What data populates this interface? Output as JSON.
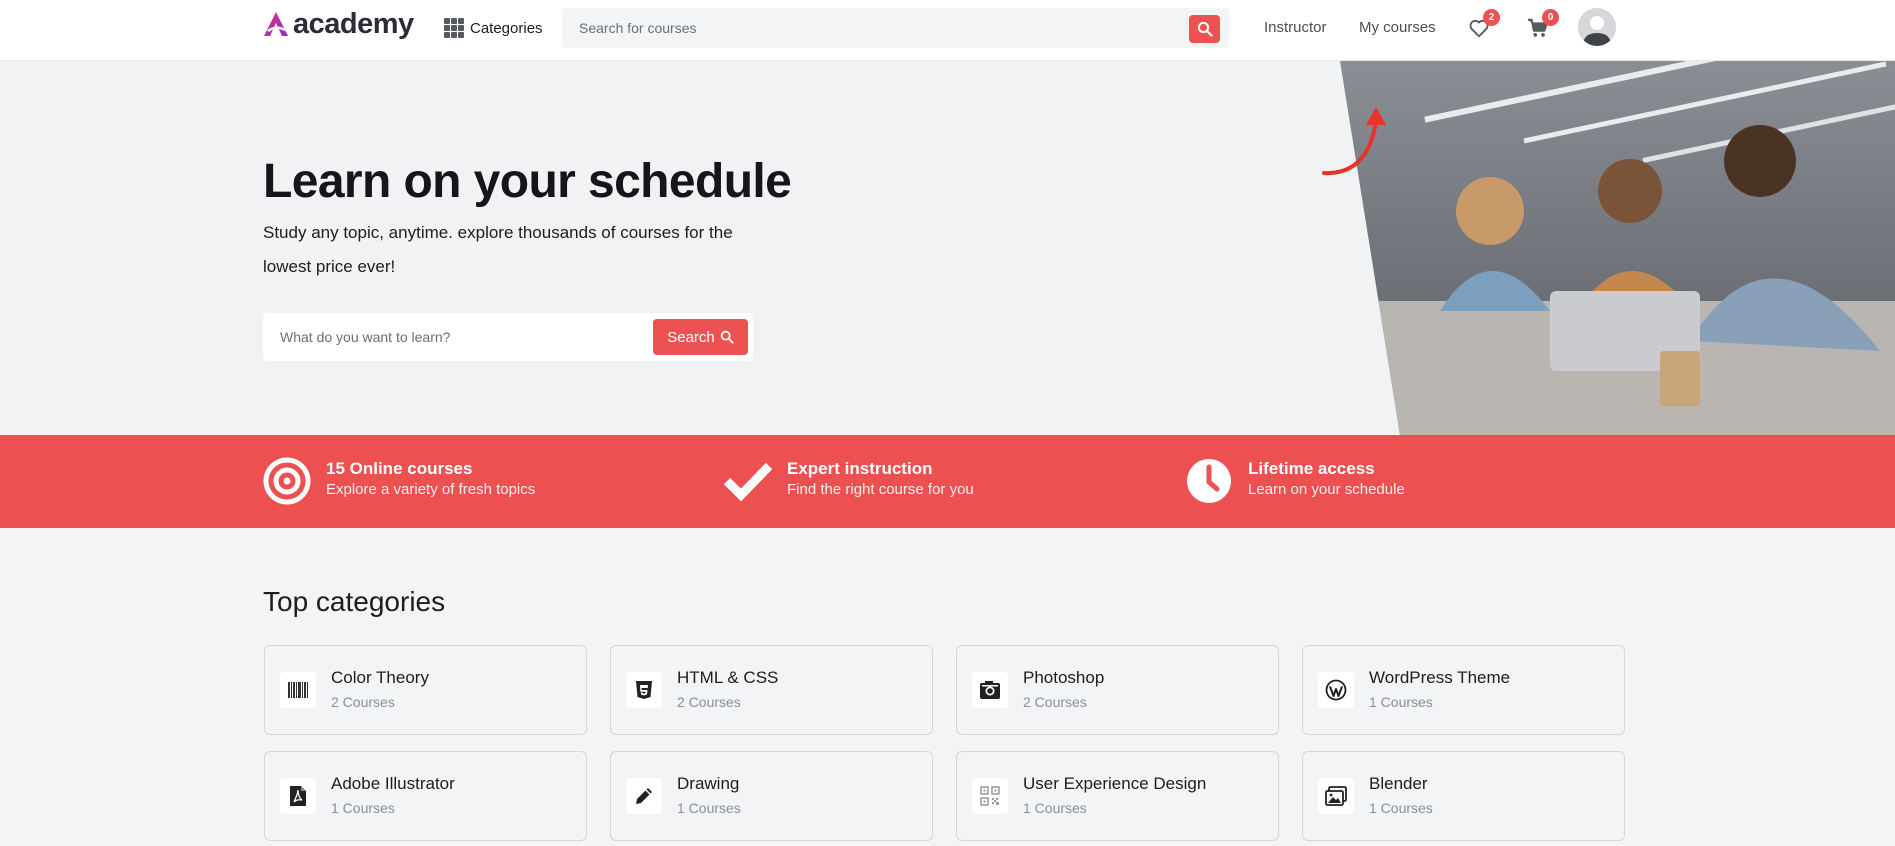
{
  "colors": {
    "accent": "#ec5252",
    "band": "#ec5050",
    "page_bg": "#f2f4f5",
    "text": "#1c1d1f"
  },
  "header": {
    "logo_text": "academy",
    "categories_label": "Categories",
    "search_placeholder": "Search for courses",
    "instructor_label": "Instructor",
    "my_courses_label": "My courses",
    "wishlist_count": "2",
    "cart_count": "0"
  },
  "hero": {
    "title": "Learn on your schedule",
    "subtitle": "Study any topic, anytime. explore thousands of courses for the lowest price ever!",
    "search_placeholder": "What do you want to learn?",
    "search_button": "Search"
  },
  "features": [
    {
      "icon": "target-icon",
      "title": "15 Online courses",
      "desc": "Explore a variety of fresh topics"
    },
    {
      "icon": "check-icon",
      "title": "Expert instruction",
      "desc": "Find the right course for you"
    },
    {
      "icon": "clock-icon",
      "title": "Lifetime access",
      "desc": "Learn on your schedule"
    }
  ],
  "categories": {
    "title": "Top categories",
    "items": [
      {
        "name": "Color Theory",
        "count": "2 Courses",
        "icon": "barcode-icon"
      },
      {
        "name": "HTML & CSS",
        "count": "2 Courses",
        "icon": "css3-icon"
      },
      {
        "name": "Photoshop",
        "count": "2 Courses",
        "icon": "camera-icon"
      },
      {
        "name": "WordPress Theme",
        "count": "1 Courses",
        "icon": "wordpress-icon"
      },
      {
        "name": "Adobe Illustrator",
        "count": "1 Courses",
        "icon": "pdf-file-icon"
      },
      {
        "name": "Drawing",
        "count": "1 Courses",
        "icon": "pencil-icon"
      },
      {
        "name": "User Experience Design",
        "count": "1 Courses",
        "icon": "qr-code-icon"
      },
      {
        "name": "Blender",
        "count": "1 Courses",
        "icon": "images-icon"
      }
    ]
  }
}
